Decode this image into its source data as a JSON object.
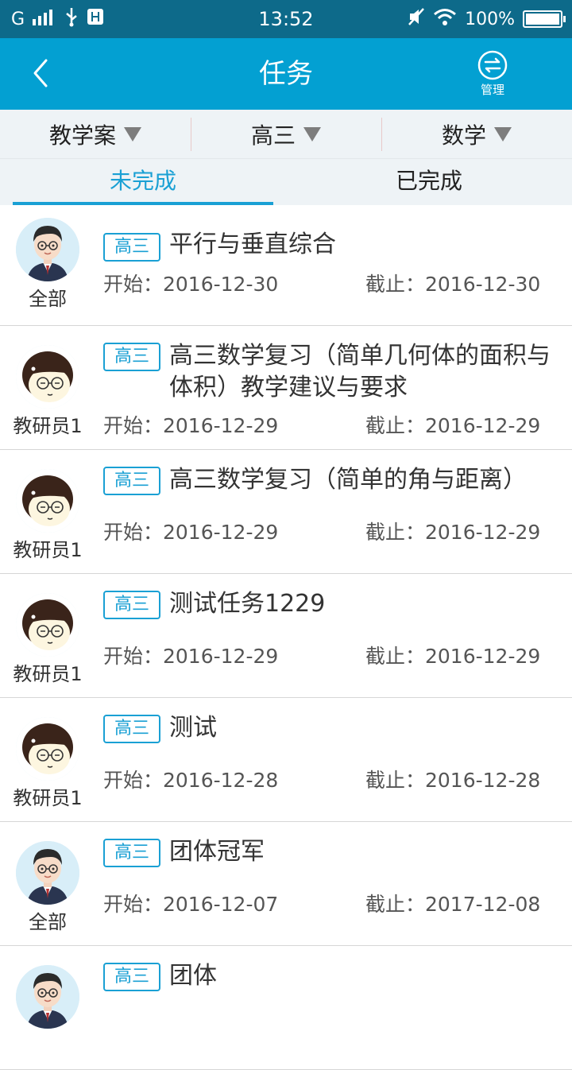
{
  "status": {
    "carrier": "G",
    "time": "13:52",
    "battery": "100%"
  },
  "appbar": {
    "title": "任务",
    "manage_label": "管理"
  },
  "filters": [
    {
      "label": "教学案"
    },
    {
      "label": "高三"
    },
    {
      "label": "数学"
    }
  ],
  "tabs": [
    {
      "label": "未完成",
      "active": true
    },
    {
      "label": "已完成",
      "active": false
    }
  ],
  "labels": {
    "start_prefix": "开始：",
    "end_prefix": "截止："
  },
  "tasks": [
    {
      "owner": "全部",
      "avatar": "male-teacher",
      "tag": "高三",
      "title": "平行与垂直综合",
      "start": "开始：2016-12-30",
      "end": "截止：2016-12-30"
    },
    {
      "owner": "教研员1",
      "avatar": "cartoon-boy",
      "tag": "高三",
      "title": "高三数学复习（简单几何体的面积与体积）教学建议与要求",
      "start": "开始：2016-12-29",
      "end": "截止：2016-12-29"
    },
    {
      "owner": "教研员1",
      "avatar": "cartoon-boy",
      "tag": "高三",
      "title": "高三数学复习（简单的角与距离）",
      "start": "开始：2016-12-29",
      "end": "截止：2016-12-29"
    },
    {
      "owner": "教研员1",
      "avatar": "cartoon-boy",
      "tag": "高三",
      "title": "测试任务1229",
      "start": "开始：2016-12-29",
      "end": "截止：2016-12-29"
    },
    {
      "owner": "教研员1",
      "avatar": "cartoon-boy",
      "tag": "高三",
      "title": "测试",
      "start": "开始：2016-12-28",
      "end": "截止：2016-12-28"
    },
    {
      "owner": "全部",
      "avatar": "male-teacher",
      "tag": "高三",
      "title": "团体冠军",
      "start": "开始：2016-12-07",
      "end": "截止：2017-12-08"
    },
    {
      "owner": "",
      "avatar": "male-teacher",
      "tag": "高三",
      "title": "团体",
      "start": "",
      "end": ""
    }
  ],
  "colors": {
    "statusbar": "#0d6a8a",
    "appbar": "#03a0d2",
    "accent": "#1aa0d4"
  }
}
